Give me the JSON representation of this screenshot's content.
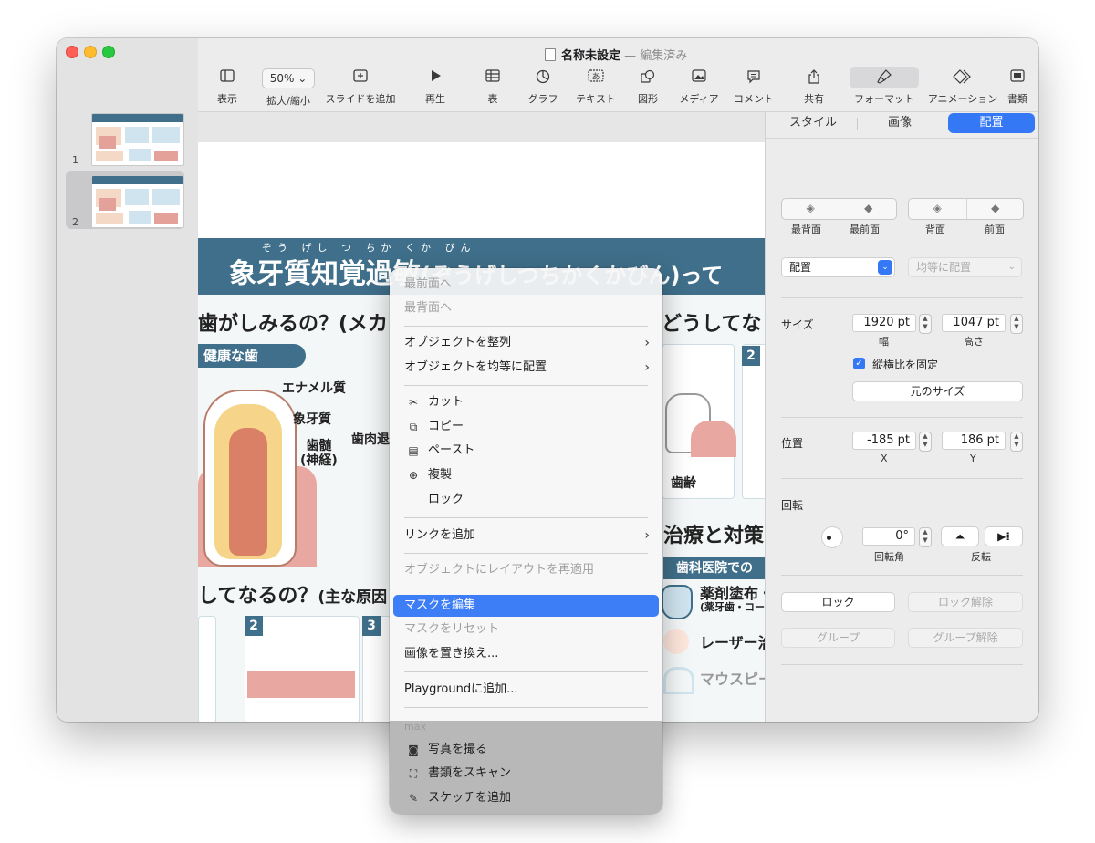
{
  "window": {
    "title": "名称未設定",
    "title_sep": "—",
    "edited": "編集済み"
  },
  "sidebar": {
    "slides": [
      {
        "num": "1",
        "selected": false
      },
      {
        "num": "2",
        "selected": true
      }
    ]
  },
  "toolbar": {
    "view": {
      "label": "表示",
      "icon": "sidebar-icon"
    },
    "zoom": {
      "value": "50%",
      "label": "拡大/縮小"
    },
    "add_slide": {
      "label": "スライドを追加",
      "icon": "plus-square-icon"
    },
    "play": {
      "label": "再生",
      "icon": "play-icon"
    },
    "table": {
      "label": "表",
      "icon": "table-icon"
    },
    "chart": {
      "label": "グラフ",
      "icon": "chart-icon"
    },
    "text": {
      "label": "テキスト",
      "icon": "text-box-icon"
    },
    "shape": {
      "label": "図形",
      "icon": "shape-icon"
    },
    "media": {
      "label": "メディア",
      "icon": "photo-icon"
    },
    "comment": {
      "label": "コメント",
      "icon": "comment-icon"
    },
    "share": {
      "label": "共有",
      "icon": "share-icon"
    },
    "format": {
      "label": "フォーマット",
      "icon": "paintbrush-icon"
    },
    "animate": {
      "label": "アニメーション",
      "icon": "diamond-icon"
    },
    "document": {
      "label": "書類",
      "icon": "document-icon"
    }
  },
  "slide": {
    "ruby": "ぞう げし つ ちか くか びん",
    "title": "象牙質知覚過敏",
    "title_suffix": "(ぞうげしつちかくかびん)って",
    "q_left": "歯がしみるの？(メカ",
    "q_right": "どうしてな",
    "healthy_tooth": "健康な歯",
    "enamel": "エナメル質",
    "dentin": "象牙質",
    "pulp": "歯髄\n(神経)",
    "gum_recession": "歯肉退",
    "age": "歯齢",
    "treatment": "治療と対策",
    "clinic": "歯科医院での",
    "why": "してなるの？",
    "why_sub": "(主な原因",
    "num_2a": "2",
    "num_2b": "2",
    "num_3": "3",
    "coating": "薬剤塗布・コ",
    "coating_sub": "(薬牙歯・コーテ",
    "laser": "レーザー治",
    "mouthpiece": "マウスピー"
  },
  "inspector": {
    "tabs": [
      "スタイル",
      "画像",
      "配置"
    ],
    "active_tab": "配置",
    "arrange": {
      "back_most": "最背面",
      "front_most": "最前面",
      "back": "背面",
      "front": "前面"
    },
    "align_popup": "配置",
    "distribute_popup": "均等に配置",
    "size": {
      "label": "サイズ",
      "width": "1920 pt",
      "width_label": "幅",
      "height": "1047 pt",
      "height_label": "高さ",
      "constrain_label": "縦横比を固定",
      "constrain_checked": true,
      "original_size": "元のサイズ"
    },
    "position": {
      "label": "位置",
      "x": "-185 pt",
      "x_label": "X",
      "y": "186 pt",
      "y_label": "Y"
    },
    "rotate": {
      "label": "回転",
      "angle": "0°",
      "angle_label": "回転角",
      "flip_label": "反転"
    },
    "lock": "ロック",
    "unlock": "ロック解除",
    "group": "グループ",
    "ungroup": "グループ解除"
  },
  "context_menu": {
    "bring_front": "最前面へ",
    "send_back": "最背面へ",
    "align_objects": "オブジェクトを整列",
    "distribute_objects": "オブジェクトを均等に配置",
    "cut": "カット",
    "copy": "コピー",
    "paste": "ペースト",
    "duplicate": "複製",
    "lock": "ロック",
    "add_link": "リンクを追加",
    "reapply_layout": "オブジェクトにレイアウトを再適用",
    "edit_mask": "マスクを編集",
    "reset_mask": "マスクをリセット",
    "replace_image": "画像を置き換え...",
    "add_to_playground": "Playgroundに追加...",
    "device_header": "max",
    "take_photo": "写真を撮る",
    "scan_documents": "書類をスキャン",
    "add_sketch": "スケッチを追加"
  }
}
